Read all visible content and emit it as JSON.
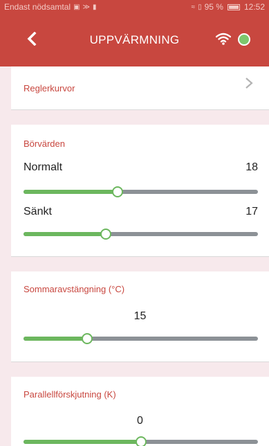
{
  "status_bar": {
    "carrier": "Endast nödsamtal",
    "battery": "95 %",
    "time": "12:52"
  },
  "app_bar": {
    "title": "UPPVÄRMNING",
    "connection_color": "#7dc66d"
  },
  "rows": {
    "curves_label": "Reglerkurvor"
  },
  "setpoints": {
    "section_label": "Börvärden",
    "normal": {
      "label": "Normalt",
      "value": "18",
      "level": 0.4
    },
    "reduced": {
      "label": "Sänkt",
      "value": "17",
      "level": 0.35
    }
  },
  "summer_shutdown": {
    "section_label": "Sommaravstängning (°C)",
    "value": "15",
    "level": 0.27
  },
  "parallel_shift": {
    "section_label": "Parallellförskjutning (K)",
    "value": "0",
    "level": 0.5
  },
  "colors": {
    "brand": "#c8473f",
    "slider_fill": "#6cb75e",
    "slider_rest": "#8c9196",
    "background": "#f7e9ec"
  }
}
